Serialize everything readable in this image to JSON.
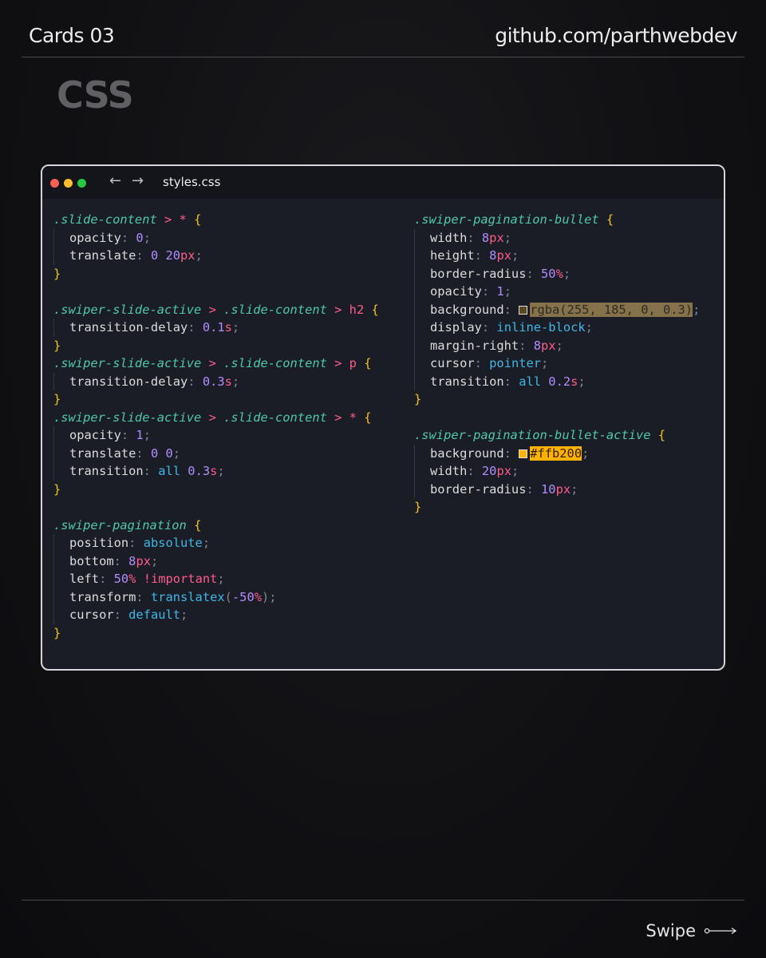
{
  "header": {
    "series_title": "Cards 03",
    "author_link": "github.com/parthwebdev"
  },
  "section_title": "CSS",
  "editor": {
    "file_name": "styles.css",
    "nav_back": "←",
    "nav_forward": "→"
  },
  "code": {
    "left": [
      [
        [
          ".slide-content",
          "sel"
        ],
        [
          " > * ",
          "op"
        ],
        [
          "{",
          "br"
        ]
      ],
      [
        [
          "",
          "guide"
        ],
        [
          "opacity",
          "prop"
        ],
        [
          ": ",
          "pu"
        ],
        [
          "0",
          "num"
        ],
        [
          ";",
          "pu"
        ]
      ],
      [
        [
          "",
          "guide"
        ],
        [
          "translate",
          "prop"
        ],
        [
          ": ",
          "pu"
        ],
        [
          "0 20",
          "num"
        ],
        [
          "px",
          "unit"
        ],
        [
          ";",
          "pu"
        ]
      ],
      [
        [
          "}",
          "br"
        ]
      ],
      [],
      [
        [
          ".swiper-slide-active",
          "sel"
        ],
        [
          " > ",
          "op"
        ],
        [
          ".slide-content",
          "sel"
        ],
        [
          " > h2 ",
          "op"
        ],
        [
          "{",
          "br"
        ]
      ],
      [
        [
          "",
          "guide"
        ],
        [
          "transition-delay",
          "prop"
        ],
        [
          ": ",
          "pu"
        ],
        [
          "0.1",
          "num"
        ],
        [
          "s",
          "unit"
        ],
        [
          ";",
          "pu"
        ]
      ],
      [
        [
          "}",
          "br"
        ]
      ],
      [
        [
          ".swiper-slide-active",
          "sel"
        ],
        [
          " > ",
          "op"
        ],
        [
          ".slide-content",
          "sel"
        ],
        [
          " > p ",
          "op"
        ],
        [
          "{",
          "br"
        ]
      ],
      [
        [
          "",
          "guide"
        ],
        [
          "transition-delay",
          "prop"
        ],
        [
          ": ",
          "pu"
        ],
        [
          "0.3",
          "num"
        ],
        [
          "s",
          "unit"
        ],
        [
          ";",
          "pu"
        ]
      ],
      [
        [
          "}",
          "br"
        ]
      ],
      [
        [
          ".swiper-slide-active",
          "sel"
        ],
        [
          " > ",
          "op"
        ],
        [
          ".slide-content",
          "sel"
        ],
        [
          " > * ",
          "op"
        ],
        [
          "{",
          "br"
        ]
      ],
      [
        [
          "",
          "guide"
        ],
        [
          "opacity",
          "prop"
        ],
        [
          ": ",
          "pu"
        ],
        [
          "1",
          "num"
        ],
        [
          ";",
          "pu"
        ]
      ],
      [
        [
          "",
          "guide"
        ],
        [
          "translate",
          "prop"
        ],
        [
          ": ",
          "pu"
        ],
        [
          "0 0",
          "num"
        ],
        [
          ";",
          "pu"
        ]
      ],
      [
        [
          "",
          "guide"
        ],
        [
          "transition",
          "prop"
        ],
        [
          ": ",
          "pu"
        ],
        [
          "all",
          "kw"
        ],
        [
          " 0.3",
          "num"
        ],
        [
          "s",
          "unit"
        ],
        [
          ";",
          "pu"
        ]
      ],
      [
        [
          "}",
          "br"
        ]
      ],
      [],
      [
        [
          ".swiper-pagination ",
          "sel"
        ],
        [
          "{",
          "br"
        ]
      ],
      [
        [
          "",
          "guide"
        ],
        [
          "position",
          "prop"
        ],
        [
          ": ",
          "pu"
        ],
        [
          "absolute",
          "kw"
        ],
        [
          ";",
          "pu"
        ]
      ],
      [
        [
          "",
          "guide"
        ],
        [
          "bottom",
          "prop"
        ],
        [
          ": ",
          "pu"
        ],
        [
          "8",
          "num"
        ],
        [
          "px",
          "unit"
        ],
        [
          ";",
          "pu"
        ]
      ],
      [
        [
          "",
          "guide"
        ],
        [
          "left",
          "prop"
        ],
        [
          ": ",
          "pu"
        ],
        [
          "50",
          "num"
        ],
        [
          "% ",
          "unit"
        ],
        [
          "!important",
          "imp"
        ],
        [
          ";",
          "pu"
        ]
      ],
      [
        [
          "",
          "guide"
        ],
        [
          "transform",
          "prop"
        ],
        [
          ": ",
          "pu"
        ],
        [
          "translatex",
          "kw"
        ],
        [
          "(",
          "pu"
        ],
        [
          "-50",
          "num"
        ],
        [
          "%",
          "unit"
        ],
        [
          ")",
          "pu"
        ],
        [
          ";",
          "pu"
        ]
      ],
      [
        [
          "",
          "guide"
        ],
        [
          "cursor",
          "prop"
        ],
        [
          ": ",
          "pu"
        ],
        [
          "default",
          "kw"
        ],
        [
          ";",
          "pu"
        ]
      ],
      [
        [
          "}",
          "br"
        ]
      ]
    ],
    "right": [
      [
        [
          ".swiper-pagination-bullet ",
          "sel"
        ],
        [
          "{",
          "br"
        ]
      ],
      [
        [
          "",
          "guide"
        ],
        [
          "width",
          "prop"
        ],
        [
          ": ",
          "pu"
        ],
        [
          "8",
          "num"
        ],
        [
          "px",
          "unit"
        ],
        [
          ";",
          "pu"
        ]
      ],
      [
        [
          "",
          "guide"
        ],
        [
          "height",
          "prop"
        ],
        [
          ": ",
          "pu"
        ],
        [
          "8",
          "num"
        ],
        [
          "px",
          "unit"
        ],
        [
          ";",
          "pu"
        ]
      ],
      [
        [
          "",
          "guide"
        ],
        [
          "border-radius",
          "prop"
        ],
        [
          ": ",
          "pu"
        ],
        [
          "50",
          "num"
        ],
        [
          "%",
          "unit"
        ],
        [
          ";",
          "pu"
        ]
      ],
      [
        [
          "",
          "guide"
        ],
        [
          "opacity",
          "prop"
        ],
        [
          ": ",
          "pu"
        ],
        [
          "1",
          "num"
        ],
        [
          ";",
          "pu"
        ]
      ],
      [
        [
          "",
          "guide"
        ],
        [
          "background",
          "prop"
        ],
        [
          ": ",
          "pu"
        ],
        [
          "",
          "swatch-rgba"
        ],
        [
          "rgba(255, 185, 0, 0.3)",
          "hl-rgba"
        ],
        [
          ";",
          "pu"
        ]
      ],
      [
        [
          "",
          "guide"
        ],
        [
          "display",
          "prop"
        ],
        [
          ": ",
          "pu"
        ],
        [
          "inline-block",
          "kw"
        ],
        [
          ";",
          "pu"
        ]
      ],
      [
        [
          "",
          "guide"
        ],
        [
          "margin-right",
          "prop"
        ],
        [
          ": ",
          "pu"
        ],
        [
          "8",
          "num"
        ],
        [
          "px",
          "unit"
        ],
        [
          ";",
          "pu"
        ]
      ],
      [
        [
          "",
          "guide"
        ],
        [
          "cursor",
          "prop"
        ],
        [
          ": ",
          "pu"
        ],
        [
          "pointer",
          "kw"
        ],
        [
          ";",
          "pu"
        ]
      ],
      [
        [
          "",
          "guide"
        ],
        [
          "transition",
          "prop"
        ],
        [
          ": ",
          "pu"
        ],
        [
          "all",
          "kw"
        ],
        [
          " 0.2",
          "num"
        ],
        [
          "s",
          "unit"
        ],
        [
          ";",
          "pu"
        ]
      ],
      [
        [
          "}",
          "br"
        ]
      ],
      [],
      [
        [
          ".swiper-pagination-bullet-active ",
          "sel"
        ],
        [
          "{",
          "br"
        ]
      ],
      [
        [
          "",
          "guide"
        ],
        [
          "background",
          "prop"
        ],
        [
          ": ",
          "pu"
        ],
        [
          "",
          "swatch-hex"
        ],
        [
          "#ffb200",
          "hl-hex"
        ],
        [
          ";",
          "pu"
        ]
      ],
      [
        [
          "",
          "guide"
        ],
        [
          "width",
          "prop"
        ],
        [
          ": ",
          "pu"
        ],
        [
          "20",
          "num"
        ],
        [
          "px",
          "unit"
        ],
        [
          ";",
          "pu"
        ]
      ],
      [
        [
          "",
          "guide"
        ],
        [
          "border-radius",
          "prop"
        ],
        [
          ": ",
          "pu"
        ],
        [
          "10",
          "num"
        ],
        [
          "px",
          "unit"
        ],
        [
          ";",
          "pu"
        ]
      ],
      [
        [
          "}",
          "br"
        ]
      ]
    ]
  },
  "colors": {
    "swatch_rgba": "#5a4a22",
    "swatch_hex": "#ffb200"
  },
  "footer": {
    "swipe_label": "Swipe"
  }
}
